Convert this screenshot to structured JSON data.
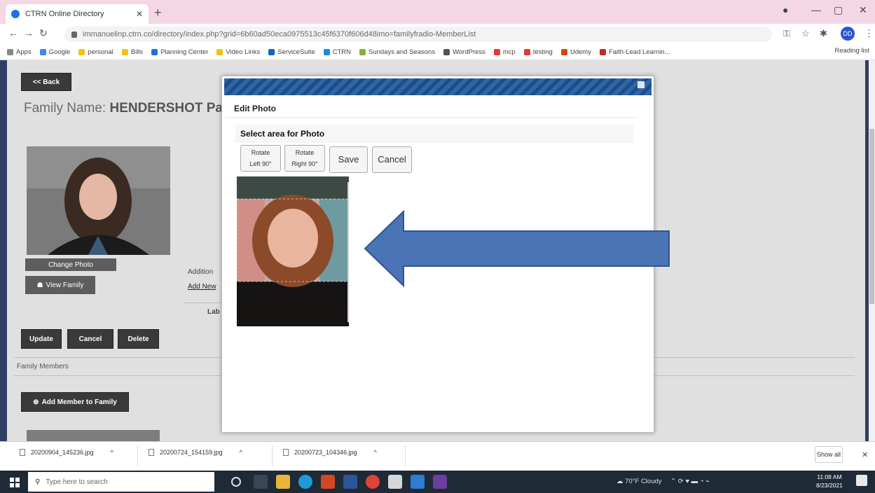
{
  "browser": {
    "tab_title": "CTRN Online Directory",
    "url": "immanuelinp.ctrn.co/directory/index.php?grid=6b60ad50eca0975513c45f6370f606d48imo=familyfradio-MemberList",
    "bookmarks": [
      "Apps",
      "Google",
      "personal",
      "Bills",
      "Planning Center",
      "Video Links",
      "ServiceSuite",
      "CTRN",
      "Sundays and Seasons",
      "WordPress",
      "mcp",
      "testing",
      "Udemy",
      "Faith-Lead Learnin..."
    ],
    "reading_list": "Reading list",
    "profile_initials": "DD"
  },
  "page": {
    "back_label": "<< Back",
    "family_label": "Family Name:",
    "family_name": "HENDERSHOT Pas",
    "change_photo": "Change Photo",
    "view_family": "View Family",
    "additional_label": "Addition",
    "add_new_link": "Add New",
    "lab_text": "Lab",
    "update": "Update",
    "cancel": "Cancel",
    "delete": "Delete",
    "family_members": "Family Members",
    "add_member": "Add Member to Family"
  },
  "modal": {
    "title": "Edit Photo",
    "section": "Select area for Photo",
    "rotate_left_1": "Rotate",
    "rotate_left_2": "Left 90°",
    "rotate_right_1": "Rotate",
    "rotate_right_2": "Right 90°",
    "save": "Save",
    "cancel": "Cancel"
  },
  "downloads": {
    "files": [
      "20200904_145236.jpg",
      "20200724_154159.jpg",
      "20200723_104346.jpg"
    ],
    "show_all": "Show all"
  },
  "taskbar": {
    "search_placeholder": "Type here to search",
    "weather": "70°F Cloudy",
    "time": "11:08 AM",
    "date": "8/23/2021"
  },
  "colors": {
    "tab_bar": "#f4d6e4",
    "page_frame": "#2f3e62",
    "modal_header": "#2e66a8",
    "arrow_fill": "#4a74b5",
    "arrow_stroke": "#2f568f"
  }
}
